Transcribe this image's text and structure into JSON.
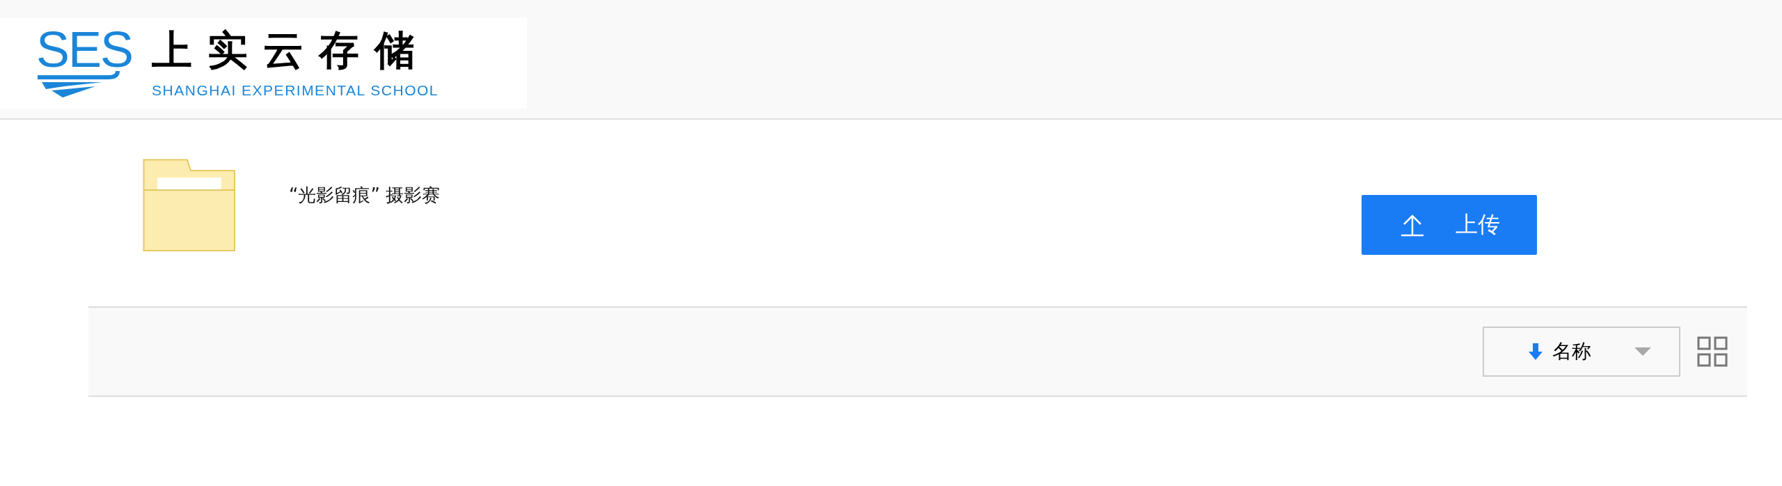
{
  "logo": {
    "mark": "SES",
    "title": "上实云存储",
    "subtitle": "SHANGHAI EXPERIMENTAL SCHOOL"
  },
  "folder": {
    "name": "“光影留痕” 摄影赛"
  },
  "upload_button": {
    "label": "上传"
  },
  "toolbar": {
    "sort": {
      "label": "名称"
    }
  }
}
